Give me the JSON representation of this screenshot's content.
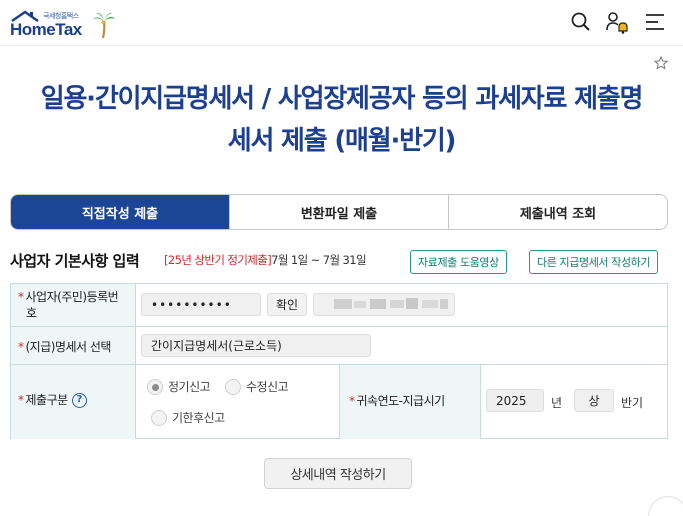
{
  "header": {
    "logo_small": "국세청홈택스",
    "logo_text": "HomeTax",
    "icons": [
      "search-icon",
      "user-alert-icon",
      "menu-icon"
    ]
  },
  "page": {
    "title_line1": "일용·간이지급명세서 / 사업장제공자 등의 과세자료 제출명",
    "title_line2": "세서 제출 (매월·반기)"
  },
  "tabs": [
    {
      "label": "직접작성 제출",
      "active": true
    },
    {
      "label": "변환파일 제출",
      "active": false
    },
    {
      "label": "제출내역 조회",
      "active": false
    }
  ],
  "section": {
    "title": "사업자 기본사항 입력",
    "period_tag": "[25년 상반기 정기제출]",
    "period_dates": "7월 1일 ~ 7월 31일",
    "guide_button": "자료제출 도움영상",
    "other_button": "다른 지급명세서 작성하기"
  },
  "form": {
    "bizno_label_1": "사업자(주민)등록번",
    "bizno_label_2": "호",
    "bizno_value": "••••••••••",
    "confirm_button": "확인",
    "statement_label": "(지급)명세서 선택",
    "statement_value": "간이지급명세서(근로소득)",
    "submit_type_label": "제출구분",
    "radio_regular": "정기신고",
    "radio_amend": "수정신고",
    "radio_late": "기한후신고",
    "selected_radio": "정기신고",
    "attribution_label": "귀속연도-지급시기",
    "year_value": "2025",
    "year_unit": "년",
    "half_value": "상",
    "half_unit": "반기"
  },
  "actions": {
    "detail_button": "상세내역 작성하기"
  },
  "colors": {
    "brand_blue": "#1c4595",
    "teal": "#1f9b8e",
    "required_red": "#d42a2a"
  }
}
